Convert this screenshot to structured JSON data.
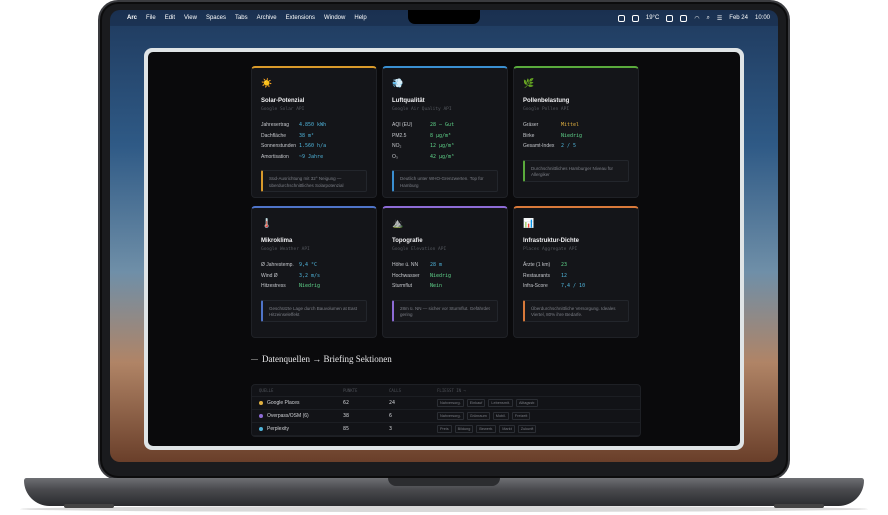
{
  "menubar": {
    "app": "Arc",
    "items": [
      "File",
      "Edit",
      "View",
      "Spaces",
      "Tabs",
      "Archive",
      "Extensions",
      "Window",
      "Help"
    ],
    "temp": "19°C",
    "date": "Feb 24",
    "time": "10:00"
  },
  "cards": [
    {
      "emoji": "☀️",
      "title": "Solar-Potenzial",
      "sub": "Google Solar API",
      "color": "#d99a2b",
      "rows": [
        {
          "k": "Jahresertrag",
          "v": "4.850 kWh",
          "vc": "#4fb3d9"
        },
        {
          "k": "Dachfläche",
          "v": "38 m²",
          "vc": "#4fb3d9"
        },
        {
          "k": "Sonnenstunden",
          "v": "1.560 h/a",
          "vc": "#4fb3d9"
        },
        {
          "k": "Amortisation",
          "v": "~9 Jahre",
          "vc": "#4fb3d9"
        }
      ],
      "note": "Süd-Ausrichtung mit 32° Neigung — überdurchschnittliches Solarpotenzial"
    },
    {
      "emoji": "💨",
      "title": "Luftqualität",
      "sub": "Google Air Quality API",
      "color": "#3a8fd1",
      "rows": [
        {
          "k": "AQI (EU)",
          "v": "28 — Gut",
          "vc": "#5fd38a"
        },
        {
          "k": "PM2.5",
          "v": "8 µg/m³",
          "vc": "#5fd38a"
        },
        {
          "k": "NO₂",
          "v": "12 µg/m³",
          "vc": "#5fd38a"
        },
        {
          "k": "O₃",
          "v": "42 µg/m³",
          "vc": "#5fd38a"
        }
      ],
      "note": "Deutlich unter WHO-Grenzwerten. Top für Hamburg"
    },
    {
      "emoji": "🌿",
      "title": "Pollenbelastung",
      "sub": "Google Pollen API",
      "color": "#5aaa3c",
      "rows": [
        {
          "k": "Gräser",
          "v": "Mittel",
          "vc": "#e0b040"
        },
        {
          "k": "Birke",
          "v": "Niedrig",
          "vc": "#5fd38a"
        },
        {
          "k": "Gesamt-Index",
          "v": "2 / 5",
          "vc": "#4fb3d9"
        }
      ],
      "note": "Durchschnittliches Hamburger Niveau für Allergiker"
    },
    {
      "emoji": "🌡️",
      "title": "Mikroklima",
      "sub": "Google Weather API",
      "color": "#4f74c8",
      "rows": [
        {
          "k": "Ø Jahrestemp.",
          "v": "9,4 °C",
          "vc": "#4fb3d9"
        },
        {
          "k": "Wind Ø",
          "v": "3,2 m/s",
          "vc": "#4fb3d9"
        },
        {
          "k": "Hitzestress",
          "v": "Niedrig",
          "vc": "#5fd38a"
        }
      ],
      "note": "Geschützte Lage durch Bauvolumen at East Hitzeinseleffekt"
    },
    {
      "emoji": "⛰️",
      "title": "Topografie",
      "sub": "Google Elevation API",
      "color": "#8d6bd6",
      "rows": [
        {
          "k": "Höhe ü. NN",
          "v": "28 m",
          "vc": "#4fb3d9"
        },
        {
          "k": "Hochwasser",
          "v": "Niedrig",
          "vc": "#5fd38a"
        },
        {
          "k": "Sturmflut",
          "v": "Nein",
          "vc": "#5fd38a"
        }
      ],
      "note": "28m ü. NN — sicher vor Sturmflut. Gefährdet gering"
    },
    {
      "emoji": "📊",
      "title": "Infrastruktur-Dichte",
      "sub": "Places Aggregate API",
      "color": "#d8793a",
      "rows": [
        {
          "k": "Ärzte (1 km)",
          "v": "23",
          "vc": "#5fd38a"
        },
        {
          "k": "Restaurants",
          "v": "12",
          "vc": "#4fb3d9"
        },
        {
          "k": "Infra-Score",
          "v": "7,4 / 10",
          "vc": "#4fb3d9"
        }
      ],
      "note": "Überdurchschnittliche Versorgung. Ideales Viertel, 80% ihre Bedarfe."
    }
  ],
  "section_title": "Datenquellen → Briefing Sektionen",
  "table": {
    "headers": [
      "QUELLE",
      "PUNKTE",
      "CALLS",
      "FLIESST IN →"
    ],
    "rows": [
      {
        "name": "Google Places",
        "dot": "#e0b040",
        "punkte": "62",
        "calls": "24",
        "tags": [
          "Nahversorg.",
          "Einkauf",
          "Lebensmit.",
          "Alltagsstr."
        ]
      },
      {
        "name": "Overpass/OSM (6)",
        "dot": "#8d6bd6",
        "punkte": "38",
        "calls": "6",
        "tags": [
          "Nahversorg.",
          "Grünraum",
          "Mobil.",
          "Freizeit"
        ]
      },
      {
        "name": "Perplexity",
        "dot": "#4fb3d9",
        "punkte": "85",
        "calls": "3",
        "tags": [
          "Preis",
          "Bildung",
          "Bewerb.",
          "Markt",
          "Zukunft"
        ]
      }
    ]
  }
}
